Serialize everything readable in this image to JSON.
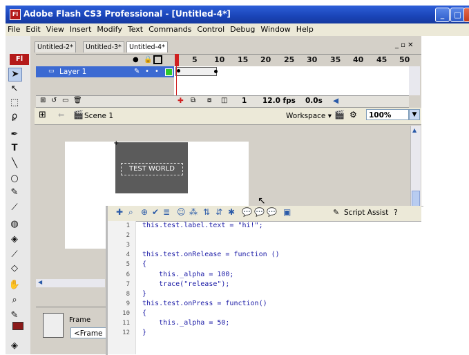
{
  "window": {
    "title": "Adobe Flash CS3 Professional - [Untitled-4*]",
    "app_badge": "Fl"
  },
  "menu": [
    "File",
    "Edit",
    "View",
    "Insert",
    "Modify",
    "Text",
    "Commands",
    "Control",
    "Debug",
    "Window",
    "Help"
  ],
  "doc_tabs": [
    "Untitled-2*",
    "Untitled-3*",
    "Untitled-4*"
  ],
  "timeline": {
    "ruler": [
      "5",
      "10",
      "15",
      "20",
      "25",
      "30",
      "35",
      "40",
      "45",
      "50"
    ],
    "layer_name": "Layer 1",
    "frame": "1",
    "fps": "12.0 fps",
    "time": "0.0s"
  },
  "editbar": {
    "scene": "Scene 1",
    "workspace": "Workspace",
    "zoom": "100%"
  },
  "stage": {
    "button_label": "TEST WORLD"
  },
  "properties": {
    "frame_label": "Frame",
    "frame_input": "<Frame"
  },
  "actions": {
    "script_assist": "Script Assist",
    "lines": [
      {
        "n": "1",
        "text": "this.test.label.text = \"hi!\";"
      },
      {
        "n": "2",
        "text": ""
      },
      {
        "n": "3",
        "text": ""
      },
      {
        "n": "4",
        "text": "this.test.onRelease = function ()"
      },
      {
        "n": "5",
        "text": "{"
      },
      {
        "n": "6",
        "text": "    this._alpha = 100;"
      },
      {
        "n": "7",
        "text": "    trace(\"release\");"
      },
      {
        "n": "8",
        "text": "}"
      },
      {
        "n": "9",
        "text": "this.test.onPress = function()"
      },
      {
        "n": "10",
        "text": "{"
      },
      {
        "n": "11",
        "text": "    this._alpha = 50;"
      },
      {
        "n": "12",
        "text": "}"
      }
    ]
  }
}
